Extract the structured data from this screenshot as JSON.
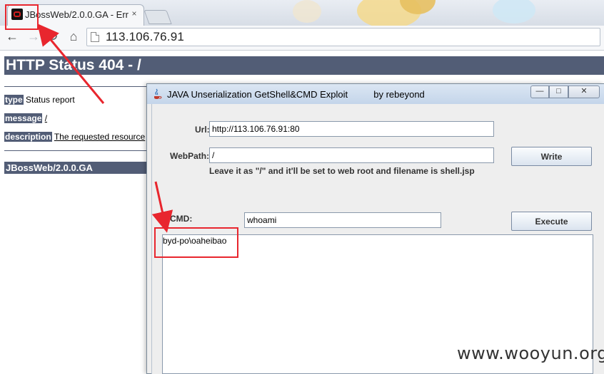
{
  "browser": {
    "tab_title": "JBossWeb/2.0.0.GA - Err",
    "tab_close": "×",
    "url": "113.106.76.91",
    "icons": [
      "back-icon",
      "forward-icon",
      "reload-icon",
      "home-icon",
      "page-icon"
    ]
  },
  "page": {
    "heading": "HTTP Status 404 - /",
    "type_label": "type",
    "type_value": "Status report",
    "message_label": "message",
    "message_value": "/",
    "description_label": "description",
    "description_value": "The requested resource",
    "footer": "JBossWeb/2.0.0.GA",
    "header_bg": "#525d76"
  },
  "java_window": {
    "title": "JAVA Unserialization GetShell&CMD Exploit          by rebeyond",
    "url_label": "Url:",
    "url_value": "http://113.106.76.91:80",
    "webpath_label": "WebPath:",
    "webpath_value": "/",
    "hint": "Leave it as \"/\" and it'll be set to web root and filename is shell.jsp",
    "write_button": "Write",
    "cmd_label": "CMD:",
    "cmd_value": "whoami",
    "execute_button": "Execute",
    "output": "byd-po\\oaheibao"
  },
  "annotations": {
    "highlight_color": "#e8262e"
  },
  "watermark": "www.wooyun.org"
}
